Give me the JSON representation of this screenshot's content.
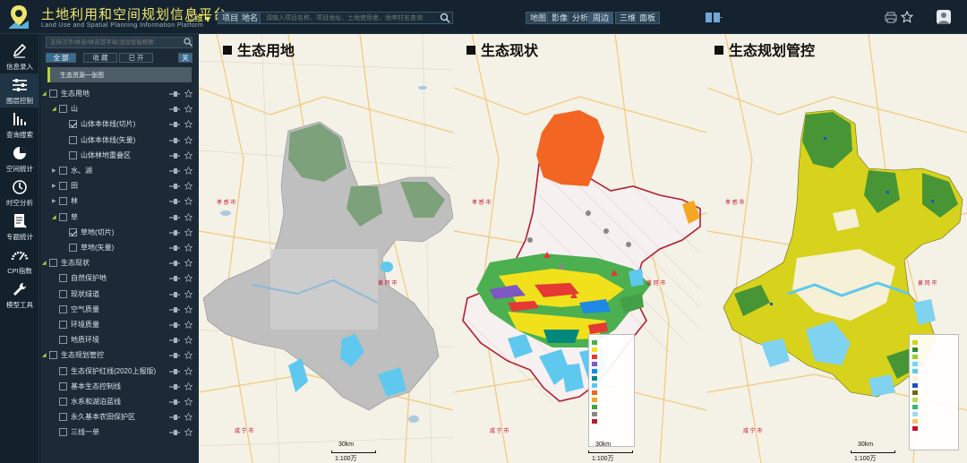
{
  "header": {
    "title_cn": "土地利用和空间规划信息平台",
    "title_en": "Land Use and Spatial Planning Information Platform",
    "mode": "二维",
    "btn_project": "项目",
    "btn_parcel": "地名",
    "search_placeholder": "请输入项目名称、项目地址、土地使用者、地申村名查询",
    "btn_map": "地图",
    "btn_image": "影像",
    "btn_analysis": "分析",
    "btn_around": "周边",
    "btn_3d": "三维",
    "btn_panel": "面板",
    "accent": "#f1e46a"
  },
  "nav": {
    "items": [
      {
        "label": "信息录入",
        "icon": "pencil-icon"
      },
      {
        "label": "图层控制",
        "icon": "sliders-icon"
      },
      {
        "label": "查询搜索",
        "icon": "bar-chart-icon"
      },
      {
        "label": "空间统计",
        "icon": "pie-icon"
      },
      {
        "label": "时空分析",
        "icon": "clock-icon"
      },
      {
        "label": "专题统计",
        "icon": "report-icon"
      },
      {
        "label": "CPI指数",
        "icon": "gauge-icon"
      },
      {
        "label": "模型工具",
        "icon": "wrench-icon"
      }
    ]
  },
  "panel": {
    "search_placeholder": "支持汉字/拼音/拼音首字母/混合智能搜索",
    "tabs": {
      "all": "全 部",
      "fav": "收 藏",
      "open": "已 开",
      "close": "关"
    },
    "bookmark": "生态资源一张图",
    "tree": [
      {
        "label": "生态用地",
        "level": 0,
        "checked": false,
        "expanded": true
      },
      {
        "label": "山",
        "level": 1,
        "checked": false,
        "expanded": true
      },
      {
        "label": "山体本体线(切片)",
        "level": 2,
        "checked": true
      },
      {
        "label": "山体本体线(矢量)",
        "level": 2,
        "checked": false
      },
      {
        "label": "山体林地重叠区",
        "level": 2,
        "checked": false
      },
      {
        "label": "水、湖",
        "level": 1,
        "checked": false,
        "expanded": false
      },
      {
        "label": "田",
        "level": 1,
        "checked": false,
        "expanded": false
      },
      {
        "label": "林",
        "level": 1,
        "checked": false,
        "expanded": false
      },
      {
        "label": "草",
        "level": 1,
        "checked": false,
        "expanded": true
      },
      {
        "label": "草地(切片)",
        "level": 2,
        "checked": true
      },
      {
        "label": "草地(矢量)",
        "level": 2,
        "checked": false
      },
      {
        "label": "生态现状",
        "level": 0,
        "checked": false,
        "expanded": true
      },
      {
        "label": "自然保护地",
        "level": 1,
        "checked": false
      },
      {
        "label": "现状绿道",
        "level": 1,
        "checked": false
      },
      {
        "label": "空气质量",
        "level": 1,
        "checked": false
      },
      {
        "label": "环境质量",
        "level": 1,
        "checked": false
      },
      {
        "label": "地质环境",
        "level": 1,
        "checked": false
      },
      {
        "label": "生态规划管控",
        "level": 0,
        "checked": false,
        "expanded": true
      },
      {
        "label": "生态保护红线(2020上报版)",
        "level": 1,
        "checked": false
      },
      {
        "label": "基本生态控制线",
        "level": 1,
        "checked": false
      },
      {
        "label": "水系和湖泊蓝线",
        "level": 1,
        "checked": false
      },
      {
        "label": "永久基本农田保护区",
        "level": 1,
        "checked": false
      },
      {
        "label": "三线一单",
        "level": 1,
        "checked": false
      }
    ]
  },
  "maps": [
    {
      "title": "生态用地",
      "scale_km": "30km",
      "scale_ratio": "1:100万"
    },
    {
      "title": "生态现状",
      "scale_km": "30km",
      "scale_ratio": "1:100万"
    },
    {
      "title": "生态规划管控",
      "scale_km": "30km",
      "scale_ratio": "1:100万"
    }
  ]
}
